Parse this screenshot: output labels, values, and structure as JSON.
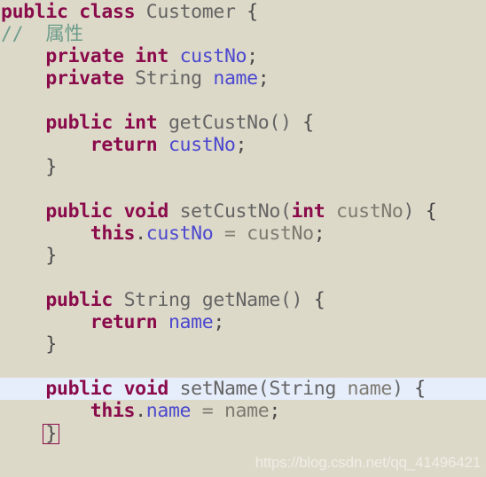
{
  "editor": {
    "language": "Java",
    "background_color": "#ddd9c9",
    "current_line_highlight_color": "#e7eefb",
    "brace_match_border_color": "#8a0b4b",
    "colors": {
      "keyword": "#8a0b4b",
      "field": "#4b48cf",
      "type": "#646464",
      "method": "#646464",
      "parameter": "#7d7a70",
      "punctuation": "#4a4a4a",
      "comment": "#6d9c8a",
      "plain": "#5f5f5f"
    }
  },
  "code": {
    "lines": [
      {
        "n": 1,
        "text": "public class Customer {",
        "highlight": false,
        "tokens": [
          {
            "t": "public",
            "k": "keyword"
          },
          {
            "t": " ",
            "k": "plain"
          },
          {
            "t": "class",
            "k": "keyword"
          },
          {
            "t": " ",
            "k": "plain"
          },
          {
            "t": "Customer",
            "k": "type"
          },
          {
            "t": " ",
            "k": "plain"
          },
          {
            "t": "{",
            "k": "punct"
          }
        ]
      },
      {
        "n": 2,
        "text": "//  属性",
        "highlight": false,
        "tokens": [
          {
            "t": "//  属性",
            "k": "comment"
          }
        ]
      },
      {
        "n": 3,
        "text": "    private int custNo;",
        "highlight": false,
        "tokens": [
          {
            "t": "    ",
            "k": "plain"
          },
          {
            "t": "private",
            "k": "keyword"
          },
          {
            "t": " ",
            "k": "plain"
          },
          {
            "t": "int",
            "k": "keyword"
          },
          {
            "t": " ",
            "k": "plain"
          },
          {
            "t": "custNo",
            "k": "field"
          },
          {
            "t": ";",
            "k": "punct"
          }
        ]
      },
      {
        "n": 4,
        "text": "    private String name;",
        "highlight": false,
        "tokens": [
          {
            "t": "    ",
            "k": "plain"
          },
          {
            "t": "private",
            "k": "keyword"
          },
          {
            "t": " ",
            "k": "plain"
          },
          {
            "t": "String",
            "k": "type"
          },
          {
            "t": " ",
            "k": "plain"
          },
          {
            "t": "name",
            "k": "field"
          },
          {
            "t": ";",
            "k": "punct"
          }
        ]
      },
      {
        "n": 5,
        "text": "",
        "highlight": false,
        "tokens": []
      },
      {
        "n": 6,
        "text": "    public int getCustNo() {",
        "highlight": false,
        "tokens": [
          {
            "t": "    ",
            "k": "plain"
          },
          {
            "t": "public",
            "k": "keyword"
          },
          {
            "t": " ",
            "k": "plain"
          },
          {
            "t": "int",
            "k": "keyword"
          },
          {
            "t": " ",
            "k": "plain"
          },
          {
            "t": "getCustNo",
            "k": "method"
          },
          {
            "t": "()",
            "k": "type"
          },
          {
            "t": " ",
            "k": "plain"
          },
          {
            "t": "{",
            "k": "punct"
          }
        ]
      },
      {
        "n": 7,
        "text": "        return custNo;",
        "highlight": false,
        "tokens": [
          {
            "t": "        ",
            "k": "plain"
          },
          {
            "t": "return",
            "k": "keyword"
          },
          {
            "t": " ",
            "k": "plain"
          },
          {
            "t": "custNo",
            "k": "field"
          },
          {
            "t": ";",
            "k": "punct"
          }
        ]
      },
      {
        "n": 8,
        "text": "    }",
        "highlight": false,
        "tokens": [
          {
            "t": "    ",
            "k": "plain"
          },
          {
            "t": "}",
            "k": "punct"
          }
        ]
      },
      {
        "n": 9,
        "text": "",
        "highlight": false,
        "tokens": []
      },
      {
        "n": 10,
        "text": "    public void setCustNo(int custNo) {",
        "highlight": false,
        "tokens": [
          {
            "t": "    ",
            "k": "plain"
          },
          {
            "t": "public",
            "k": "keyword"
          },
          {
            "t": " ",
            "k": "plain"
          },
          {
            "t": "void",
            "k": "keyword"
          },
          {
            "t": " ",
            "k": "plain"
          },
          {
            "t": "setCustNo",
            "k": "method"
          },
          {
            "t": "(",
            "k": "type"
          },
          {
            "t": "int",
            "k": "keyword"
          },
          {
            "t": " ",
            "k": "plain"
          },
          {
            "t": "custNo",
            "k": "param"
          },
          {
            "t": ")",
            "k": "type"
          },
          {
            "t": " ",
            "k": "plain"
          },
          {
            "t": "{",
            "k": "punct"
          }
        ]
      },
      {
        "n": 11,
        "text": "        this.custNo = custNo;",
        "highlight": false,
        "tokens": [
          {
            "t": "        ",
            "k": "plain"
          },
          {
            "t": "this",
            "k": "keyword"
          },
          {
            "t": ".",
            "k": "punct"
          },
          {
            "t": "custNo",
            "k": "field"
          },
          {
            "t": " = ",
            "k": "param"
          },
          {
            "t": "custNo",
            "k": "param"
          },
          {
            "t": ";",
            "k": "punct"
          }
        ]
      },
      {
        "n": 12,
        "text": "    }",
        "highlight": false,
        "tokens": [
          {
            "t": "    ",
            "k": "plain"
          },
          {
            "t": "}",
            "k": "punct"
          }
        ]
      },
      {
        "n": 13,
        "text": "",
        "highlight": false,
        "tokens": []
      },
      {
        "n": 14,
        "text": "    public String getName() {",
        "highlight": false,
        "tokens": [
          {
            "t": "    ",
            "k": "plain"
          },
          {
            "t": "public",
            "k": "keyword"
          },
          {
            "t": " ",
            "k": "plain"
          },
          {
            "t": "String",
            "k": "type"
          },
          {
            "t": " ",
            "k": "plain"
          },
          {
            "t": "getName",
            "k": "method"
          },
          {
            "t": "()",
            "k": "type"
          },
          {
            "t": " ",
            "k": "plain"
          },
          {
            "t": "{",
            "k": "punct"
          }
        ]
      },
      {
        "n": 15,
        "text": "        return name;",
        "highlight": false,
        "tokens": [
          {
            "t": "        ",
            "k": "plain"
          },
          {
            "t": "return",
            "k": "keyword"
          },
          {
            "t": " ",
            "k": "plain"
          },
          {
            "t": "name",
            "k": "field"
          },
          {
            "t": ";",
            "k": "punct"
          }
        ]
      },
      {
        "n": 16,
        "text": "    }",
        "highlight": false,
        "tokens": [
          {
            "t": "    ",
            "k": "plain"
          },
          {
            "t": "}",
            "k": "punct"
          }
        ]
      },
      {
        "n": 17,
        "text": "",
        "highlight": false,
        "tokens": []
      },
      {
        "n": 18,
        "text": "    public void setName(String name) {",
        "highlight": true,
        "tokens": [
          {
            "t": "    ",
            "k": "plain"
          },
          {
            "t": "public",
            "k": "keyword"
          },
          {
            "t": " ",
            "k": "plain"
          },
          {
            "t": "void",
            "k": "keyword"
          },
          {
            "t": " ",
            "k": "plain"
          },
          {
            "t": "setName",
            "k": "method"
          },
          {
            "t": "(",
            "k": "type"
          },
          {
            "t": "String",
            "k": "type"
          },
          {
            "t": " ",
            "k": "plain"
          },
          {
            "t": "name",
            "k": "param"
          },
          {
            "t": ")",
            "k": "type"
          },
          {
            "t": " ",
            "k": "plain"
          },
          {
            "t": "{",
            "k": "punct"
          }
        ]
      },
      {
        "n": 19,
        "text": "        this.name = name;",
        "highlight": false,
        "tokens": [
          {
            "t": "        ",
            "k": "plain"
          },
          {
            "t": "this",
            "k": "keyword"
          },
          {
            "t": ".",
            "k": "punct"
          },
          {
            "t": "name",
            "k": "field"
          },
          {
            "t": " = ",
            "k": "param"
          },
          {
            "t": "name",
            "k": "param"
          },
          {
            "t": ";",
            "k": "punct"
          }
        ]
      },
      {
        "n": 20,
        "text": "    }",
        "highlight": false,
        "brace_match": true,
        "tokens": [
          {
            "t": "    ",
            "k": "plain"
          },
          {
            "t": "}",
            "k": "punct",
            "box": true
          }
        ]
      }
    ]
  },
  "watermark": {
    "text": "https://blog.csdn.net/qq_41496421"
  }
}
